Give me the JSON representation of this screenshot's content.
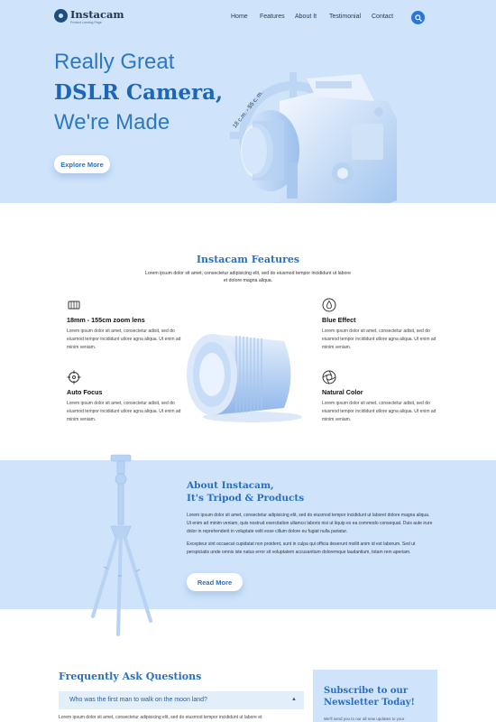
{
  "brand": {
    "name": "Instacam",
    "tagline": "Product Landing Page"
  },
  "nav": {
    "items": [
      "Home",
      "Features",
      "About It",
      "Testimonial",
      "Contact"
    ]
  },
  "hero": {
    "line1": "Really Great",
    "line2": "DSLR Camera,",
    "line3": "We're Made",
    "dimension": "18 c.m. - 55 c. m.",
    "cta": "Explore More"
  },
  "features": {
    "title": "Instacam Features",
    "subtitle": "Lorem ipsum dolor sit amet, consectetur adipisicing elit, sed do eiusmod tempor incididunt ut labore et dolore magna aliqua.",
    "items": [
      {
        "icon": "lens-icon",
        "title": "18mm - 155cm zoom lens",
        "text": "Lorem ipsum dolor sit amet, consectetur adisit, sed do eiusmod tempor incididunt utlore agna aliqua. Ut enim ad minim veniam."
      },
      {
        "icon": "drop-icon",
        "title": "Blue Effect",
        "text": "Lorem ipsum dolor sit amet, consectetur adisit, sed do eiusmod tempor incididunt utlore agna aliqua. Ut enim ad minim veniam."
      },
      {
        "icon": "crosshair-icon",
        "title": "Auto Focus",
        "text": "Lorem ipsum dolor sit amet, consectetur adisit, sed do eiusmod tempor incididunt utlore agna aliqua. Ut enim ad minim veniam."
      },
      {
        "icon": "aperture-icon",
        "title": "Natural Color",
        "text": "Lorem ipsum dolor sit amet, consectetur adisit, sed do eiusmod tempor incididunt utlore agna aliqua. Ut enim ad minim veniam."
      }
    ]
  },
  "about": {
    "title1": "About Instacam,",
    "title2": "It's Tripod & Products",
    "p1": "Lorem ipsum dolor sit amet, consectetur adipisicing elit, sed do eiusmod tempor incididunt ut laboret dolore magna aliqua. Ut enim ad minim veniam, quis nostrud exercitation ullamco laboris nisi ut liquip ex ea commodo consequat. Duis aute irure dolor in reprehenderit in voluptate velit esse cillum dolore eu fugiat nulla pariatur.",
    "p2": "Excepteur sint occaecat cupidatat non proident, sunt in culpa qui officia deserunt mollit anim id est laborum. Sed ut perspiciatis unde omnis iste natus error sit voluptatem accusantium doloremque laudantium, totam rem aperiam.",
    "cta": "Read More"
  },
  "faq": {
    "title": "Frequently Ask Questions",
    "question": "Who was the first man to walk on the moon land?",
    "answer": "Lorem ipsum dolor sit amet, consectetur adipisicing elit, sed do eiusmod tempor incididunt ut labore et"
  },
  "subscribe": {
    "title1": "Subscribe to our",
    "title2": "Newsletter Today!",
    "text": "We'll send you to our all new updates to your"
  },
  "colors": {
    "accent": "#2b76d2",
    "hero_bg": "#cfe3fb",
    "heading": "#2b6fbe"
  }
}
